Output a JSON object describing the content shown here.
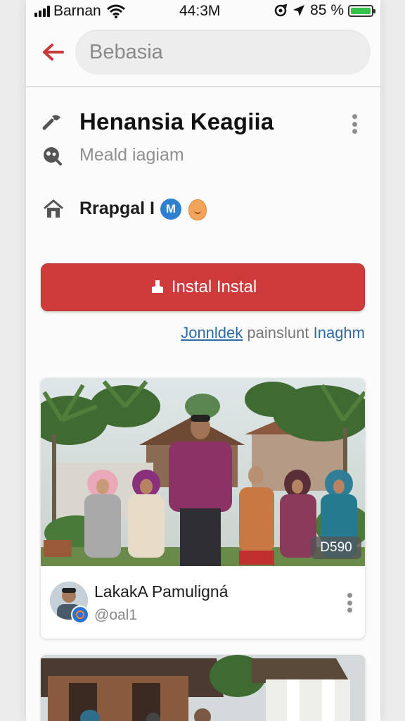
{
  "status_bar": {
    "carrier": "Barnan",
    "time": "44:3M",
    "battery": "85 %",
    "battery_level": 1.0,
    "battery_color": "#36c24a"
  },
  "search": {
    "placeholder": "Bebasia"
  },
  "app": {
    "title": "Henansia Keagiia",
    "subtitle": "Meald iagiam",
    "developer": "Rrapgal I",
    "badge_letter": "M",
    "install_label": "Instal Instal",
    "accent_color": "#cf3b3b"
  },
  "links": {
    "link1": "Jonnldek",
    "middle": "painslunt",
    "link2": "Inaghm"
  },
  "feed": [
    {
      "duration": "D590",
      "channel_name": "LakakA Pamuligná",
      "handle": "@oal1"
    }
  ],
  "icons": {
    "back": "back-arrow-icon",
    "title_icon": "tools-icon",
    "subtitle_icon": "globe-icon",
    "developer_icon": "home-icon",
    "install_icon": "download-icon",
    "more": "more-vert-icon"
  }
}
